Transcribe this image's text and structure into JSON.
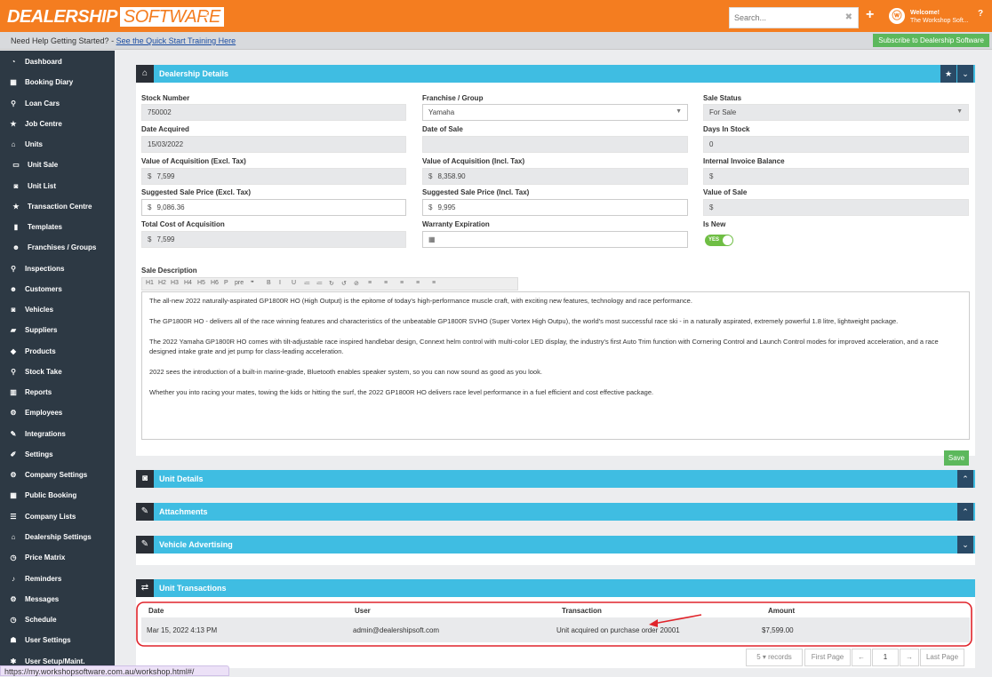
{
  "topbar": {
    "logo_part1": "DEALERSHIP",
    "logo_part2": "SOFTWARE",
    "search_placeholder": "Search...",
    "welcome_line1": "Welcome!",
    "welcome_line2": "The Workshop Soft..."
  },
  "subbar": {
    "help_text": "Need Help Getting Started? -",
    "help_link": "See the Quick Start Training Here",
    "subscribe": "Subscribe to Dealership Software"
  },
  "sidebar": {
    "items": [
      {
        "label": "Dashboard",
        "icon": "dashboard-icon",
        "glyph": "◔"
      },
      {
        "label": "Booking Diary",
        "icon": "calendar-icon",
        "glyph": "▦"
      },
      {
        "label": "Loan Cars",
        "icon": "search-icon",
        "glyph": "⚲"
      },
      {
        "label": "Job Centre",
        "icon": "star-icon",
        "glyph": "★"
      },
      {
        "label": "Units",
        "icon": "bank-icon",
        "glyph": "⌂"
      },
      {
        "label": "Unit Sale",
        "icon": "card-icon",
        "glyph": "▭"
      },
      {
        "label": "Unit List",
        "icon": "car-icon",
        "glyph": "◙"
      },
      {
        "label": "Transaction Centre",
        "icon": "star-icon",
        "glyph": "★"
      },
      {
        "label": "Templates",
        "icon": "file-icon",
        "glyph": "▮"
      },
      {
        "label": "Franchises / Groups",
        "icon": "users-icon",
        "glyph": "☻"
      },
      {
        "label": "Inspections",
        "icon": "search-icon",
        "glyph": "⚲"
      },
      {
        "label": "Customers",
        "icon": "users-icon",
        "glyph": "☻"
      },
      {
        "label": "Vehicles",
        "icon": "car-icon",
        "glyph": "◙"
      },
      {
        "label": "Suppliers",
        "icon": "truck-icon",
        "glyph": "▰"
      },
      {
        "label": "Products",
        "icon": "tag-icon",
        "glyph": "◆"
      },
      {
        "label": "Stock Take",
        "icon": "search-icon",
        "glyph": "⚲"
      },
      {
        "label": "Reports",
        "icon": "bar-chart-icon",
        "glyph": "▥"
      },
      {
        "label": "Employees",
        "icon": "cogs-icon",
        "glyph": "⚙"
      },
      {
        "label": "Integrations",
        "icon": "plug-icon",
        "glyph": "✎"
      },
      {
        "label": "Settings",
        "icon": "wrench-icon",
        "glyph": "✐"
      },
      {
        "label": "Company Settings",
        "icon": "gear-icon",
        "glyph": "⚙"
      },
      {
        "label": "Public Booking",
        "icon": "calendar-icon",
        "glyph": "▦"
      },
      {
        "label": "Company Lists",
        "icon": "list-icon",
        "glyph": "☰"
      },
      {
        "label": "Dealership Settings",
        "icon": "bank-icon",
        "glyph": "⌂"
      },
      {
        "label": "Price Matrix",
        "icon": "clock-icon",
        "glyph": "◷"
      },
      {
        "label": "Reminders",
        "icon": "bell-icon",
        "glyph": "♪"
      },
      {
        "label": "Messages",
        "icon": "gear-icon",
        "glyph": "⚙"
      },
      {
        "label": "Schedule",
        "icon": "clock-icon",
        "glyph": "◷"
      },
      {
        "label": "User Settings",
        "icon": "user-icon",
        "glyph": "☗"
      },
      {
        "label": "User Setup/Maint.",
        "icon": "asterisk-icon",
        "glyph": "✱"
      }
    ]
  },
  "dealership": {
    "title": "Dealership Details",
    "labels": {
      "stock_number": "Stock Number",
      "franchise": "Franchise / Group",
      "sale_status": "Sale Status",
      "date_acquired": "Date Acquired",
      "date_of_sale": "Date of Sale",
      "days_in_stock": "Days In Stock",
      "acq_excl": "Value of Acquisition (Excl. Tax)",
      "acq_incl": "Value of Acquisition (Incl. Tax)",
      "invoice_balance": "Internal Invoice Balance",
      "sugg_excl": "Suggested Sale Price (Excl. Tax)",
      "sugg_incl": "Suggested Sale Price (Incl. Tax)",
      "value_of_sale": "Value of Sale",
      "total_cost": "Total Cost of Acquisition",
      "warranty": "Warranty Expiration",
      "is_new": "Is New",
      "sale_description": "Sale Description"
    },
    "values": {
      "stock_number": "750002",
      "franchise": "Yamaha",
      "sale_status": "For Sale",
      "date_acquired": "15/03/2022",
      "date_of_sale": "",
      "days_in_stock": "0",
      "acq_excl": "7,599",
      "acq_incl": "8,358.90",
      "invoice_balance": "",
      "sugg_excl": "9,086.36",
      "sugg_incl": "9,995",
      "value_of_sale": "",
      "total_cost": "7,599",
      "warranty": "",
      "is_new": "YES"
    },
    "currency": "$",
    "toolbar": [
      "H1",
      "H2",
      "H3",
      "H4",
      "H5",
      "H6",
      "P",
      "pre",
      "❞",
      "B",
      "I",
      "U",
      "≔",
      "≔",
      "↻",
      "↺",
      "⊘",
      "≡",
      "≡",
      "≡",
      "≡",
      "≡"
    ],
    "description": [
      "The all-new 2022 naturally-aspirated GP1800R HO (High Output) is the epitome of today's high-performance muscle craft, with exciting new features, technology and race performance.",
      "The GP1800R HO - delivers all of the race winning features and characteristics of the unbeatable GP1800R SVHO (Super Vortex High Outpu), the world's most successful race ski - in a naturally aspirated, extremely powerful 1.8 litre, lightweight package.",
      "The 2022 Yamaha GP1800R HO comes with tilt-adjustable race inspired handlebar design, Connext helm control with multi-color LED display, the industry's first Auto Trim function with Cornering Control and Launch Control modes for improved acceleration, and a race designed intake grate and jet pump for class-leading acceleration.",
      "2022 sees the introduction of a built-in marine-grade, Bluetooth enables speaker system, so you can now sound as good as you look.",
      "Whether you into racing your mates, towing the kids or hitting the surf, the 2022 GP1800R HO delivers race level performance in a fuel efficient and cost effective package."
    ],
    "save": "Save"
  },
  "sections": {
    "unit_details": "Unit Details",
    "attachments": "Attachments",
    "vehicle_advertising": "Vehicle Advertising",
    "unit_transactions": "Unit Transactions"
  },
  "transactions": {
    "headers": [
      "Date",
      "User",
      "Transaction",
      "Amount"
    ],
    "rows": [
      [
        "Mar 15, 2022 4:13 PM",
        "admin@dealershipsoft.com",
        "Unit acquired on purchase order 20001",
        "$7,599.00"
      ]
    ]
  },
  "pager": {
    "page_size": "5",
    "records": "records",
    "first": "First Page",
    "prev": "←",
    "current": "1",
    "next": "→",
    "last": "Last Page"
  },
  "status_url": "https://my.workshopsoftware.com.au/workshop.html#/",
  "colors": {
    "topbar": "#f47d20",
    "panel_header": "#3fbde2",
    "sidebar": "#2d3944",
    "annotation": "#e0242b",
    "save": "#5cb85c"
  }
}
